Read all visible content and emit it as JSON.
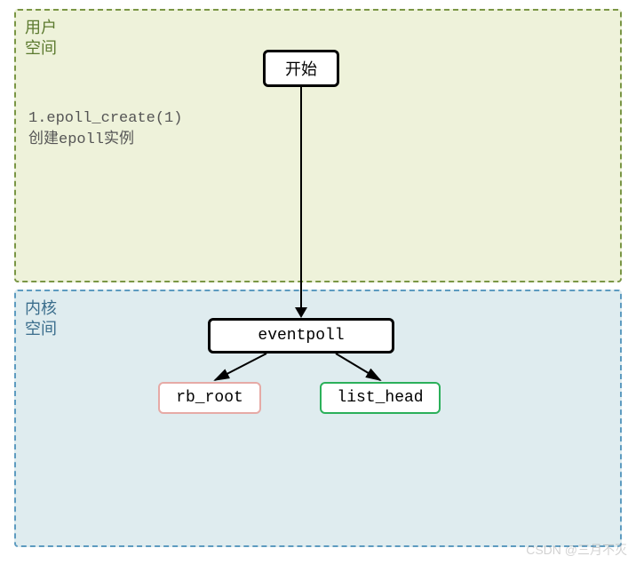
{
  "user_space": {
    "label": "用户\n空间",
    "bg": "#eef2da",
    "border": "#7a9645",
    "step_text": "1.epoll_create(1)\n创建epoll实例",
    "start_node": "开始"
  },
  "kernel_space": {
    "label": "内核\n空间",
    "bg": "#dfecef",
    "border": "#5d9bc0",
    "eventpoll": "eventpoll",
    "rb_root": "rb_root",
    "list_head": "list_head",
    "rb_root_border": "#e6aaa6",
    "list_head_border": "#2bb05a"
  },
  "watermark": "CSDN @三月不灭"
}
